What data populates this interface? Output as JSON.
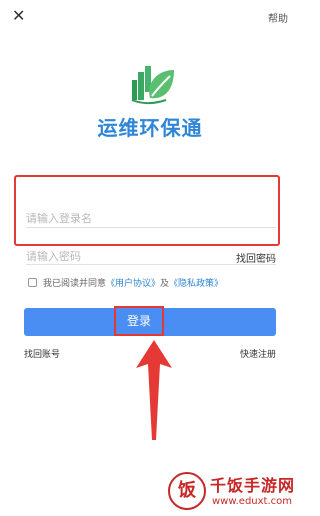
{
  "header": {
    "close_icon": "close-icon",
    "help_label": "帮助"
  },
  "app": {
    "title": "运维环保通",
    "logo_icon": "leaf-city-logo"
  },
  "login_form": {
    "username_placeholder": "请输入登录名",
    "password_placeholder": "请输入密码",
    "forgot_password": "找回密码"
  },
  "agreement": {
    "prefix": "我已阅读并同意",
    "user_agreement": "《用户协议》",
    "conjunction": "及",
    "privacy_policy": "《隐私政策》"
  },
  "login_button": "登录",
  "links": {
    "find_account": "找回账号",
    "quick_register": "快速注册"
  },
  "watermark": {
    "logo_char": "饭",
    "title": "千饭手游网",
    "url": "www.eduxt.com"
  },
  "colors": {
    "accent": "#2f86d6",
    "button": "#4a8ef3",
    "highlight": "#e53935",
    "logo_green": "#4caf50"
  }
}
